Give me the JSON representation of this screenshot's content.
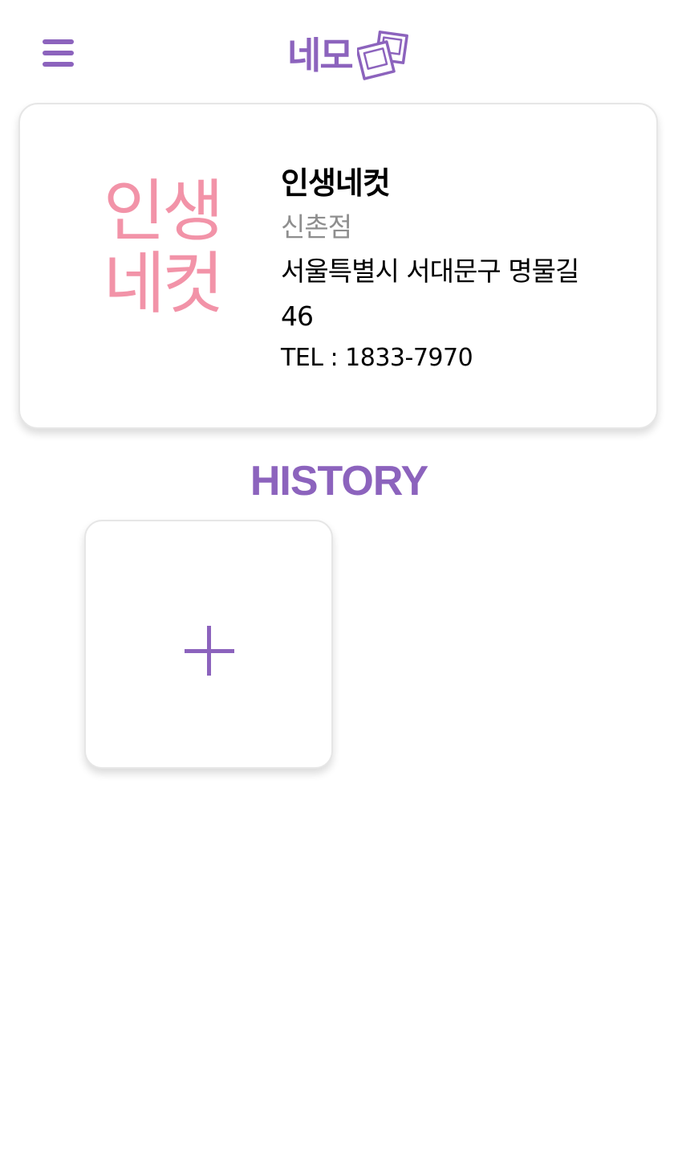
{
  "app": {
    "logo_text": "네모",
    "accent_color": "#8c63bd",
    "menu_icon": "hamburger-menu-icon",
    "logo_icon": "photo-frames-icon"
  },
  "store": {
    "brand_logo_text": [
      "인생",
      "네컷"
    ],
    "brand_logo_color": "#f293a8",
    "name": "인생네컷",
    "branch": "신촌점",
    "address": "서울특별시 서대문구 명물길 46",
    "tel": "TEL : 1833-7970"
  },
  "history": {
    "title": "HISTORY",
    "add_icon": "plus-icon"
  }
}
